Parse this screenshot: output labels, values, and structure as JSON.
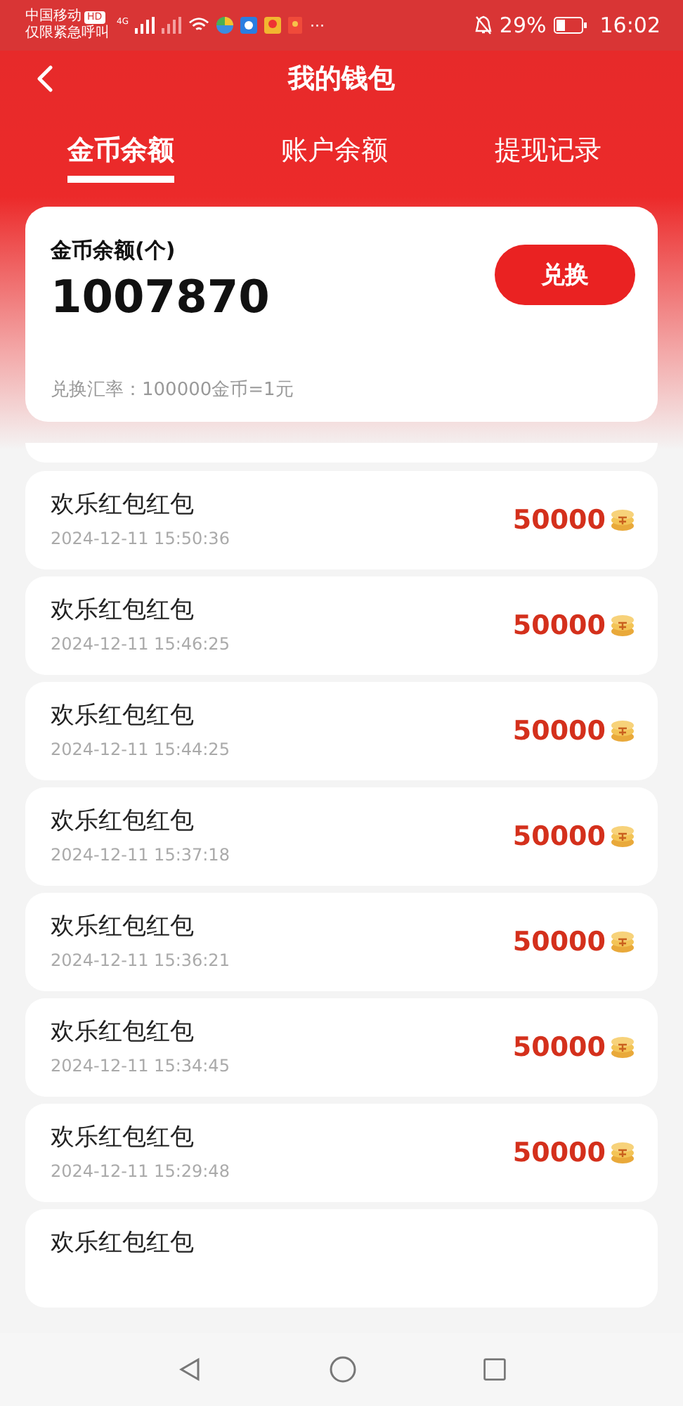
{
  "status_bar": {
    "carrier": "中国移动",
    "carrier_badge": "HD",
    "emergency": "仅限紧急呼叫",
    "network": "4G",
    "more": "···",
    "battery": "29%",
    "time": "16:02"
  },
  "header": {
    "title": "我的钱包"
  },
  "tabs": [
    {
      "label": "金币余额",
      "selected": true
    },
    {
      "label": "账户余额",
      "selected": false
    },
    {
      "label": "提现记录",
      "selected": false
    }
  ],
  "balance": {
    "label": "金币余额(个)",
    "value": "1007870",
    "button": "兑换",
    "rate": "兑换汇率：100000金币=1元"
  },
  "records": [
    {
      "title": "欢乐红包红包",
      "time": "2024-12-11 15:50:36",
      "amount": "50000"
    },
    {
      "title": "欢乐红包红包",
      "time": "2024-12-11 15:46:25",
      "amount": "50000"
    },
    {
      "title": "欢乐红包红包",
      "time": "2024-12-11 15:44:25",
      "amount": "50000"
    },
    {
      "title": "欢乐红包红包",
      "time": "2024-12-11 15:37:18",
      "amount": "50000"
    },
    {
      "title": "欢乐红包红包",
      "time": "2024-12-11 15:36:21",
      "amount": "50000"
    },
    {
      "title": "欢乐红包红包",
      "time": "2024-12-11 15:34:45",
      "amount": "50000"
    },
    {
      "title": "欢乐红包红包",
      "time": "2024-12-11 15:29:48",
      "amount": "50000"
    },
    {
      "title": "欢乐红包红包"
    }
  ]
}
